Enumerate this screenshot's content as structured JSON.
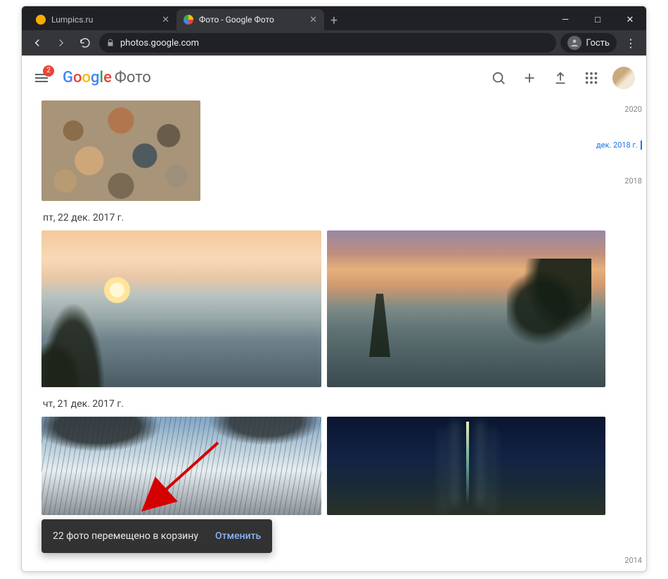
{
  "browser": {
    "tabs": [
      {
        "title": "Lumpics.ru",
        "active": false
      },
      {
        "title": "Фото - Google Фото",
        "active": true
      }
    ],
    "url": "photos.google.com",
    "guest_label": "Гость"
  },
  "header": {
    "menu_badge": "2",
    "logo_text": "Google",
    "app_name": "Фото"
  },
  "timeline": {
    "years": [
      {
        "label": "2020",
        "active": false
      },
      {
        "label": "дек. 2018 г.",
        "active": true
      },
      {
        "label": "2018",
        "active": false
      },
      {
        "label": "2014",
        "active": false
      }
    ]
  },
  "sections": [
    {
      "date": "пт, 22 дек. 2017 г."
    },
    {
      "date": "чт, 21 дек. 2017 г."
    }
  ],
  "toast": {
    "message": "22 фото перемещено в корзину",
    "undo": "Отменить"
  }
}
